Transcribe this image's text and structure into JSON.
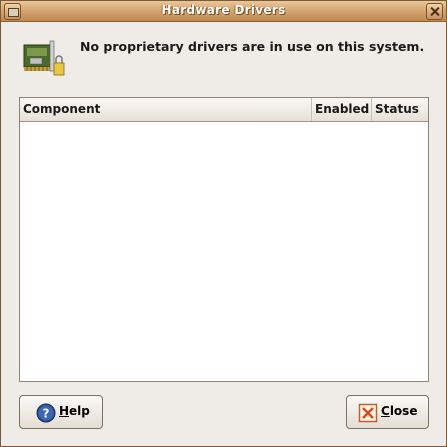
{
  "window": {
    "title": "Hardware Drivers",
    "colors": {
      "titlebar": "#d6a771",
      "background": "#efebe7"
    }
  },
  "header": {
    "icon": "pci-card-icon",
    "message": "No proprietary drivers are in use on this system."
  },
  "list": {
    "columns": [
      "Component",
      "Enabled",
      "Status"
    ],
    "rows": []
  },
  "buttons": {
    "help": {
      "label_underlined": "H",
      "label_rest": "elp",
      "icon": "help-icon"
    },
    "close": {
      "label_underlined": "C",
      "label_rest": "lose",
      "icon": "close-icon"
    }
  }
}
